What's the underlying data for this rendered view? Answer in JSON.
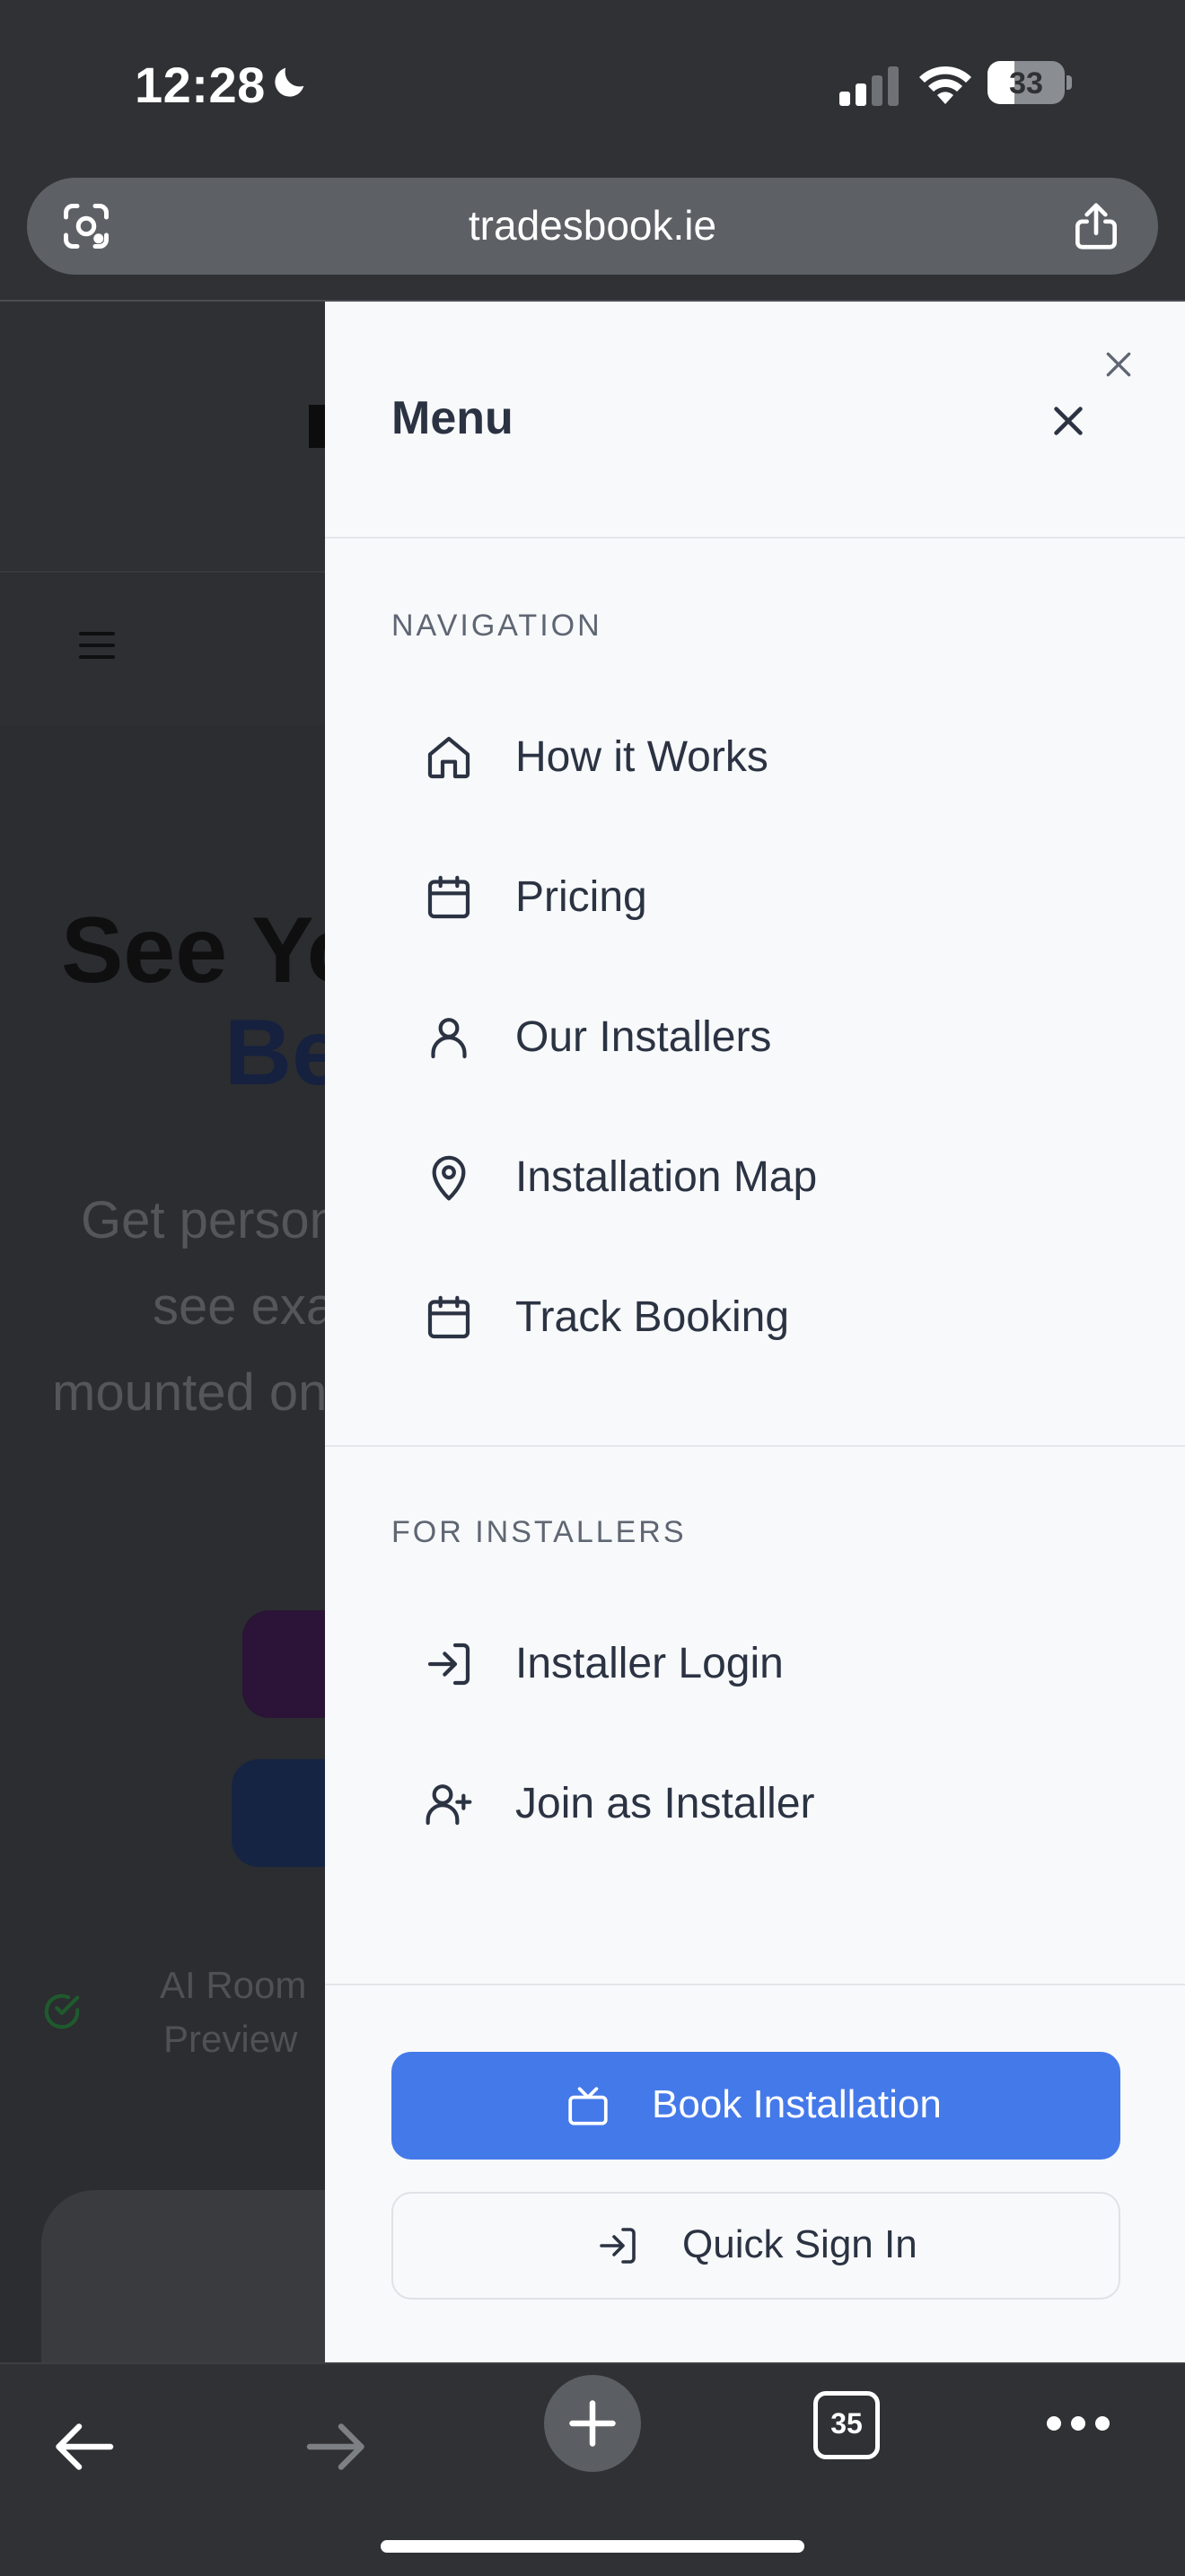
{
  "status_bar": {
    "time": "12:28",
    "battery": "33",
    "moon_icon": "moon-icon",
    "signal_icon": "cellular-signal-icon",
    "wifi_icon": "wifi-icon"
  },
  "browser": {
    "url": "tradesbook.ie",
    "tab_count": "35"
  },
  "background_page": {
    "headline_1": "See Yo",
    "headline_2": "Be",
    "paragraph_1": "Get person",
    "paragraph_2": "see exa",
    "paragraph_3": "mounted on",
    "feature_1": "AI Room",
    "feature_2": "Preview"
  },
  "drawer": {
    "title": "Menu",
    "navigation_heading": "NAVIGATION",
    "navigation_items": [
      {
        "label": "How it Works",
        "icon": "home-icon"
      },
      {
        "label": "Pricing",
        "icon": "calendar-icon"
      },
      {
        "label": "Our Installers",
        "icon": "user-icon"
      },
      {
        "label": "Installation Map",
        "icon": "map-pin-icon"
      },
      {
        "label": "Track Booking",
        "icon": "calendar-icon"
      }
    ],
    "installers_heading": "FOR INSTALLERS",
    "installer_items": [
      {
        "label": "Installer Login",
        "icon": "login-icon"
      },
      {
        "label": "Join as Installer",
        "icon": "user-plus-icon"
      }
    ],
    "primary_button": "Book Installation",
    "secondary_button": "Quick Sign In"
  },
  "colors": {
    "primary": "#4479e9",
    "drawer_bg": "#f8f9fa",
    "text": "#2b3343",
    "muted": "#5f6673",
    "chrome": "#2f3135"
  }
}
